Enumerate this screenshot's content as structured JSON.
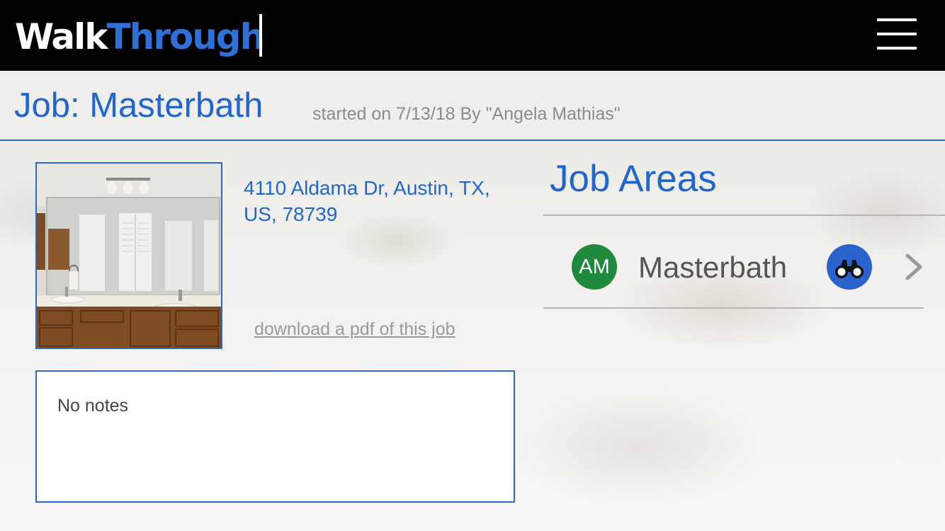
{
  "app": {
    "logo_part1": "Walk",
    "logo_part2": "Through"
  },
  "header": {
    "menu_icon": "hamburger-menu-icon"
  },
  "job": {
    "title": "Job: Masterbath",
    "meta": "started on 7/13/18 By \"Angela Mathias\"",
    "address": "4110 Aldama Dr, Austin, TX, US, 78739",
    "pdf_link": "download a pdf of this job",
    "notes": "No notes"
  },
  "areas": {
    "title": "Job Areas",
    "items": [
      {
        "avatar_initials": "AM",
        "name": "Masterbath",
        "action_icon": "binoculars-icon",
        "nav_icon": "chevron-right-icon"
      }
    ]
  },
  "colors": {
    "brand_blue": "#2f6fd8",
    "title_blue": "#1f66cf",
    "top_bar": "#000000",
    "avatar_green": "#1f8a3b",
    "muted_text": "#8c8c8c"
  }
}
